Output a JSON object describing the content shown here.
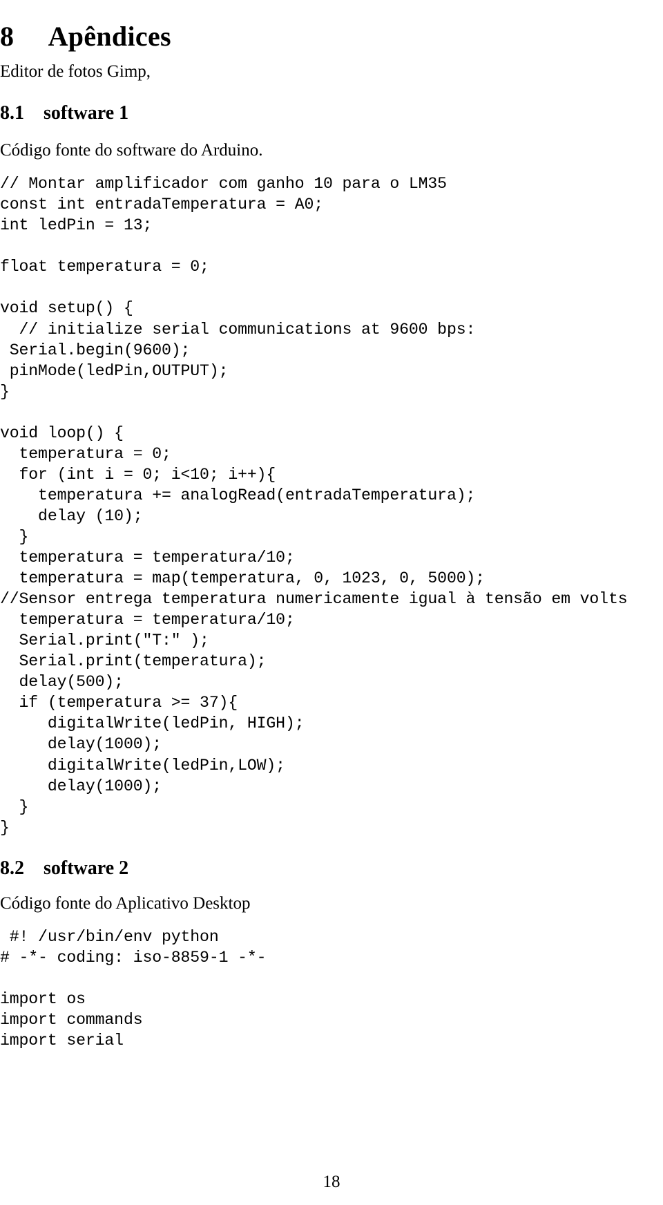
{
  "document": {
    "page_number": "18",
    "section_heading": {
      "number": "8",
      "title": "Apêndices",
      "full": "8     Apêndices"
    },
    "intro_line": "Editor de fotos Gimp,",
    "subsections": [
      {
        "number": "8.1",
        "title": "software 1",
        "full": "8.1    software 1",
        "caption": "Código fonte do software do Arduino.",
        "language": "arduino-c",
        "code_lines": [
          "// Montar amplificador com ganho 10 para o LM35",
          "const int entradaTemperatura = A0;",
          "int ledPin = 13;",
          "",
          "float temperatura = 0;",
          "",
          "void setup() {",
          "  // initialize serial communications at 9600 bps:",
          " Serial.begin(9600);",
          " pinMode(ledPin,OUTPUT);",
          "}",
          "",
          "void loop() {",
          "  temperatura = 0;",
          "  for (int i = 0; i<10; i++){",
          "    temperatura += analogRead(entradaTemperatura);",
          "    delay (10);",
          "  }",
          "  temperatura = temperatura/10;",
          "  temperatura = map(temperatura, 0, 1023, 0, 5000);",
          "//Sensor entrega temperatura numericamente igual à tensão em volts",
          "  temperatura = temperatura/10;",
          "  Serial.print(\"T:\" );",
          "  Serial.print(temperatura);",
          "  delay(500);",
          "  if (temperatura >= 37){",
          "     digitalWrite(ledPin, HIGH);",
          "     delay(1000);",
          "     digitalWrite(ledPin,LOW);",
          "     delay(1000);",
          "  }",
          "}"
        ]
      },
      {
        "number": "8.2",
        "title": "software 2",
        "full": "8.2    software 2",
        "caption": "Código fonte do Aplicativo Desktop",
        "language": "python",
        "code_lines": [
          " #! /usr/bin/env python",
          "# -*- coding: iso-8859-1 -*-",
          "",
          "import os",
          "import commands",
          "import serial"
        ]
      }
    ]
  }
}
